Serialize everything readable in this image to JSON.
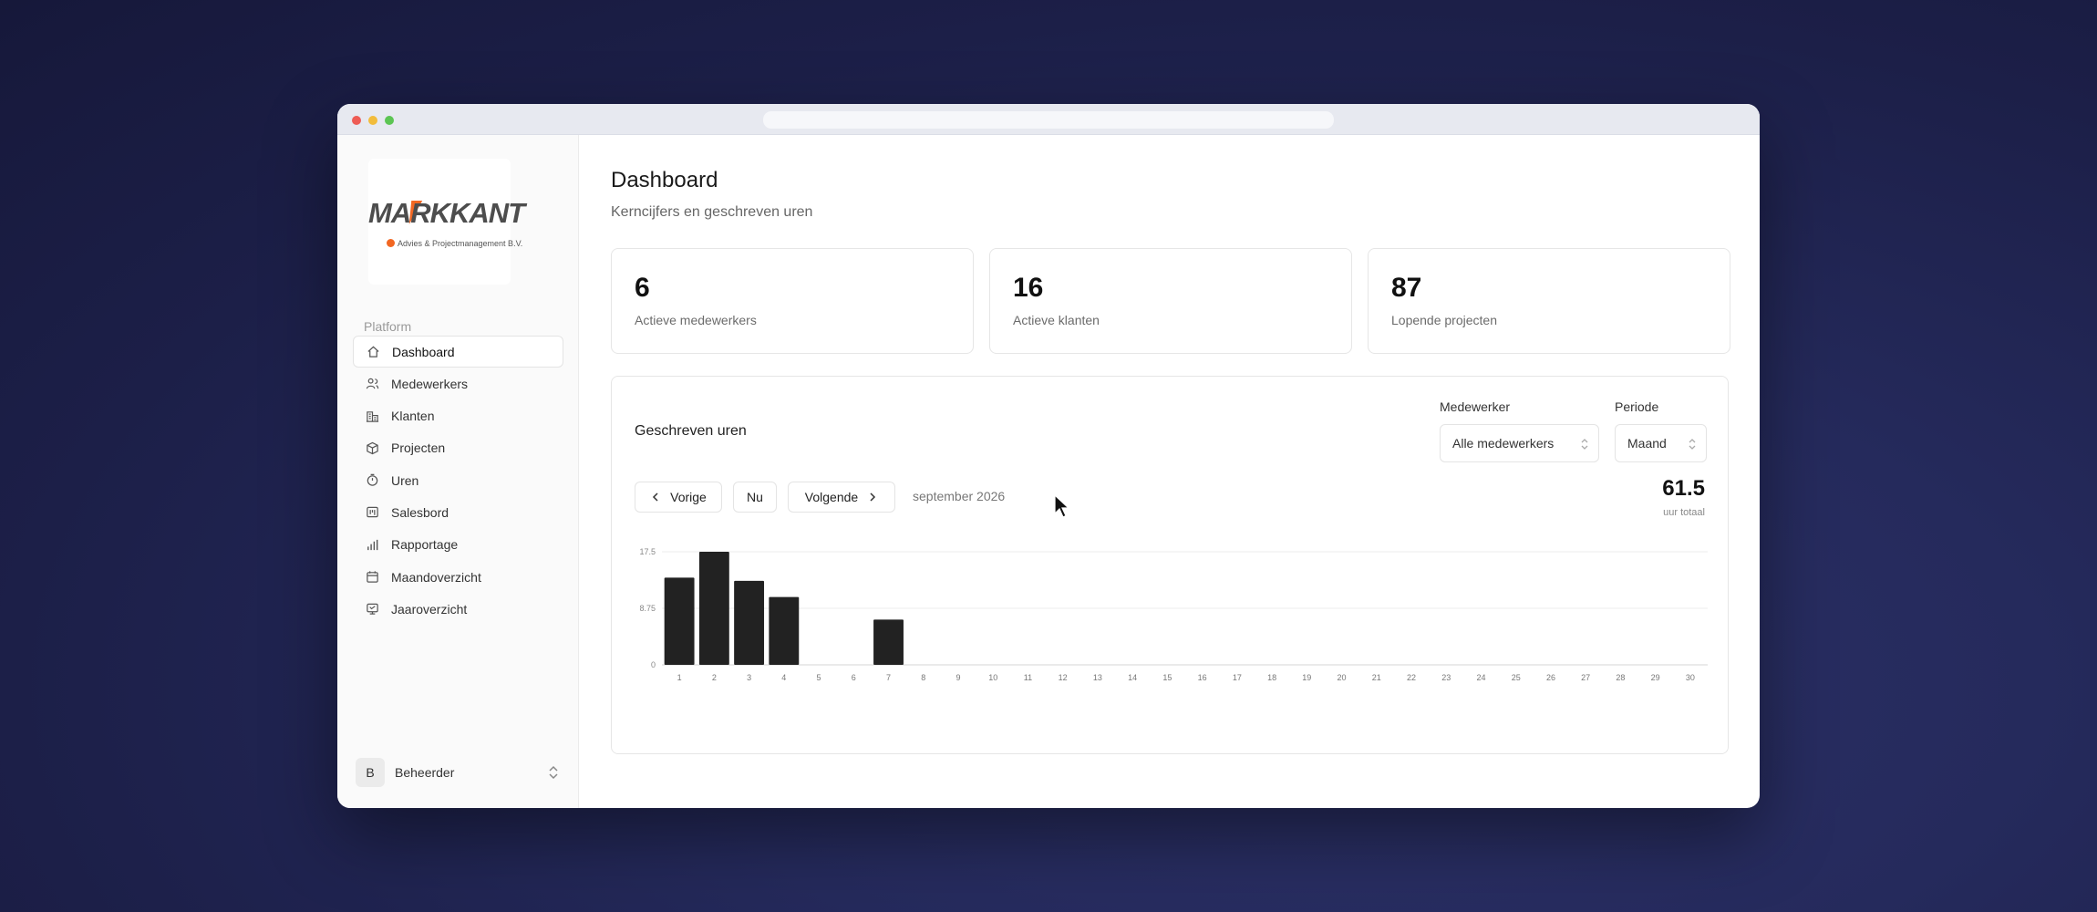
{
  "sidebar": {
    "logo": {
      "name": "MARKKANT",
      "tagline": "Advies & Projectmanagement B.V."
    },
    "section_label": "Platform",
    "items": [
      {
        "label": "Dashboard",
        "icon": "home-icon",
        "active": true
      },
      {
        "label": "Medewerkers",
        "icon": "users-icon",
        "active": false
      },
      {
        "label": "Klanten",
        "icon": "building-icon",
        "active": false
      },
      {
        "label": "Projecten",
        "icon": "package-icon",
        "active": false
      },
      {
        "label": "Uren",
        "icon": "timer-icon",
        "active": false
      },
      {
        "label": "Salesbord",
        "icon": "kanban-icon",
        "active": false
      },
      {
        "label": "Rapportage",
        "icon": "bar-chart-icon",
        "active": false
      },
      {
        "label": "Maandoverzicht",
        "icon": "calendar-icon",
        "active": false
      },
      {
        "label": "Jaaroverzicht",
        "icon": "calendar-year-icon",
        "active": false
      }
    ],
    "user": {
      "initial": "B",
      "name": "Beheerder"
    }
  },
  "header": {
    "title": "Dashboard",
    "subtitle": "Kerncijfers en geschreven uren"
  },
  "stats": [
    {
      "value": "6",
      "label": "Actieve medewerkers"
    },
    {
      "value": "16",
      "label": "Actieve klanten"
    },
    {
      "value": "87",
      "label": "Lopende projecten"
    }
  ],
  "hours_card": {
    "title": "Geschreven uren",
    "employee_filter": {
      "label": "Medewerker",
      "value": "Alle medewerkers"
    },
    "period_filter": {
      "label": "Periode",
      "value": "Maand"
    },
    "prev_label": "Vorige",
    "now_label": "Nu",
    "next_label": "Volgende",
    "period_text": "september 2026",
    "total_value": "61.5",
    "total_label": "uur totaal"
  },
  "colors": {
    "accent": "#f26722",
    "bar": "#222222",
    "background": "#1f2350"
  },
  "chart_data": {
    "type": "bar",
    "categories": [
      "1",
      "2",
      "3",
      "4",
      "5",
      "6",
      "7",
      "8",
      "9",
      "10",
      "11",
      "12",
      "13",
      "14",
      "15",
      "16",
      "17",
      "18",
      "19",
      "20",
      "21",
      "22",
      "23",
      "24",
      "25",
      "26",
      "27",
      "28",
      "29",
      "30"
    ],
    "values": [
      13.5,
      17.5,
      13,
      10.5,
      0,
      0,
      7,
      0,
      0,
      0,
      0,
      0,
      0,
      0,
      0,
      0,
      0,
      0,
      0,
      0,
      0,
      0,
      0,
      0,
      0,
      0,
      0,
      0,
      0,
      0
    ],
    "yticks": [
      "0",
      "8.75",
      "17.5"
    ],
    "ylim": [
      0,
      17.5
    ],
    "grid": true
  }
}
